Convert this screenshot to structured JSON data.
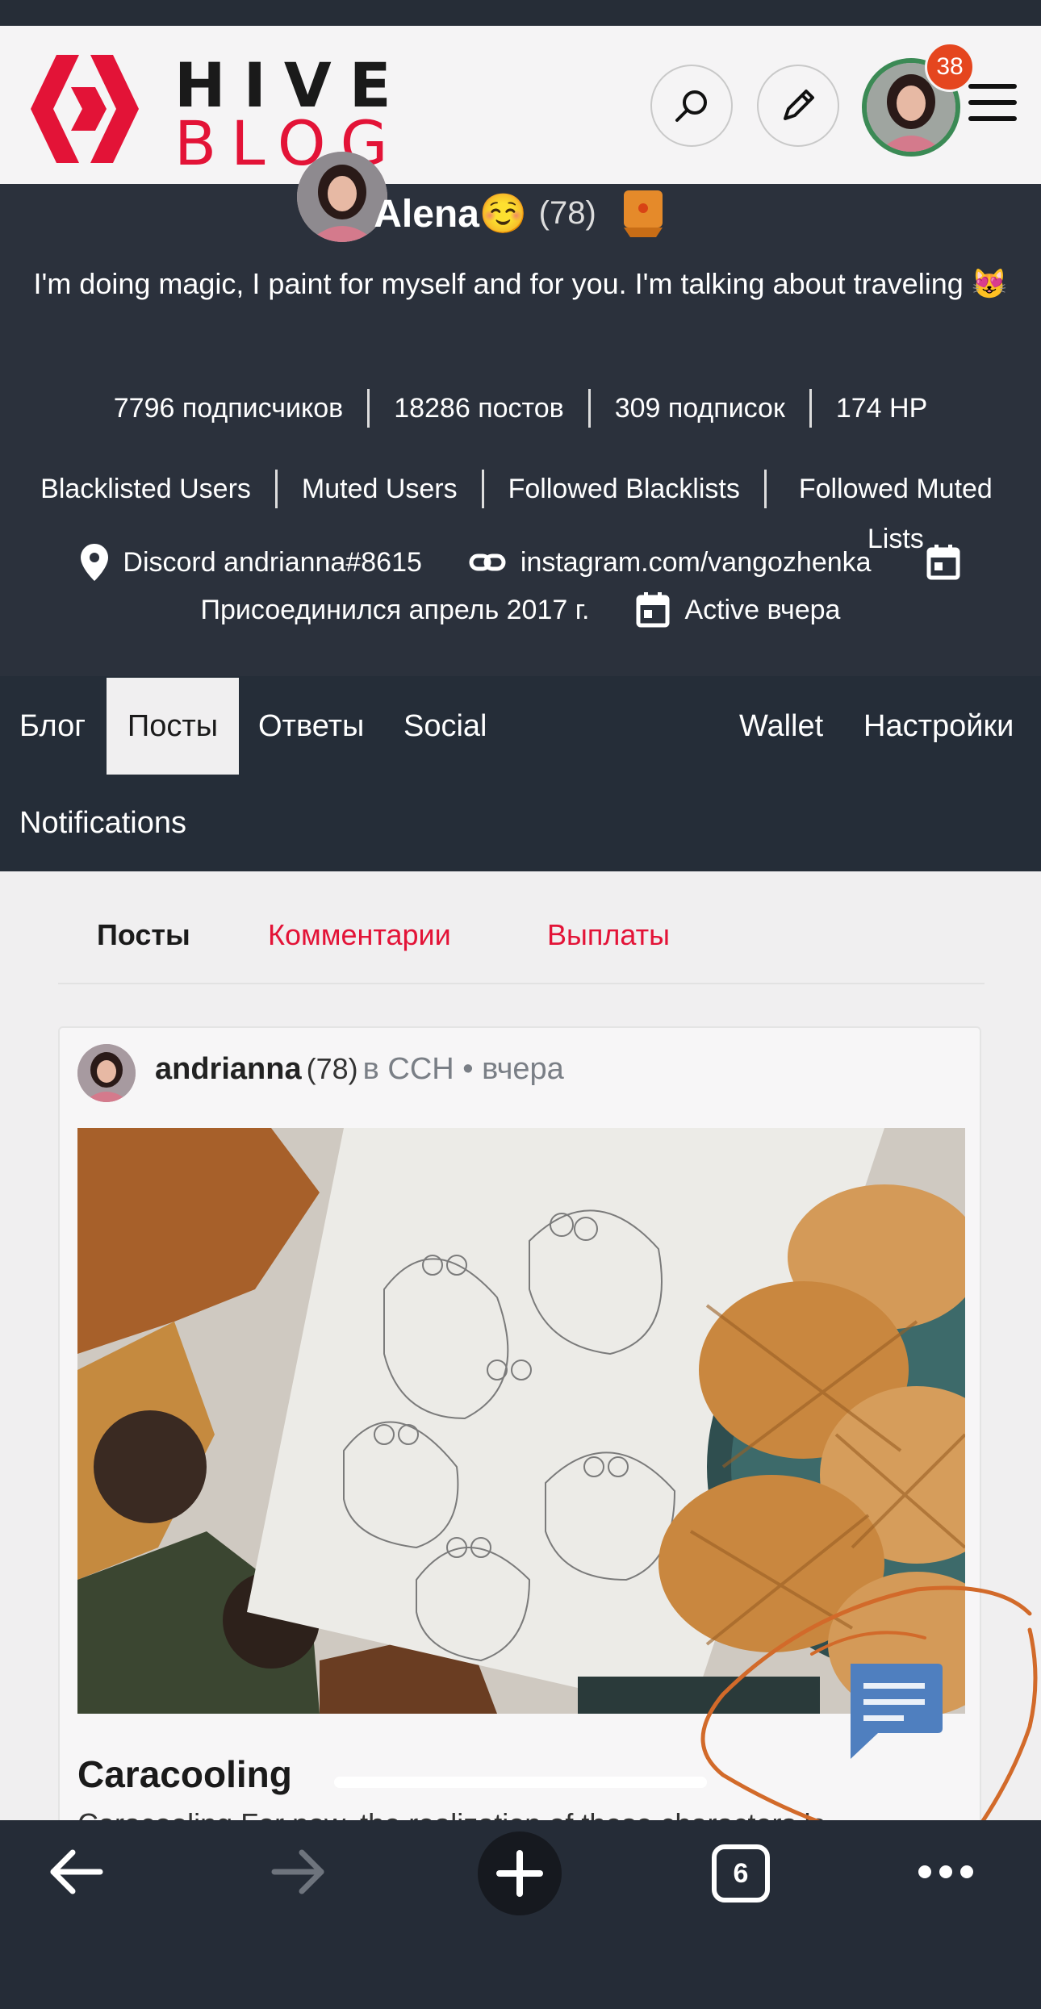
{
  "header": {
    "logo_top": "HIVE",
    "logo_bottom": "BLOG",
    "notification_count": "38",
    "brand_color": "#e31337"
  },
  "profile": {
    "name": "Alena☺️",
    "reputation": "(78)",
    "about": "I'm doing magic, I paint for myself and for you. I'm talking about traveling 😻",
    "followers": "7796 подписчиков",
    "posts": "18286 постов",
    "following": "309 подписок",
    "hp": "174 HP",
    "blacklisted_users": "Blacklisted Users",
    "muted_users": "Muted Users",
    "followed_blacklists": "Followed Blacklists",
    "followed_muted_lists": "Followed Muted Lists",
    "location": "Discord andrianna#8615",
    "website": "instagram.com/vangozhenka",
    "joined": "Присоединился апрель 2017 г.",
    "active": "Active вчера"
  },
  "tabs": {
    "blog": "Блог",
    "posts": "Посты",
    "replies": "Ответы",
    "social": "Social",
    "wallet": "Wallet",
    "settings": "Настройки",
    "notifications": "Notifications"
  },
  "subtabs": {
    "posts": "Посты",
    "comments": "Комментарии",
    "payouts": "Выплаты"
  },
  "post": {
    "author": "andrianna",
    "reputation": "(78)",
    "community_meta": "в ССН • вчера",
    "title": "Caracooling",
    "snippet": "Caracooling For now, the realization of these characters is"
  },
  "browser": {
    "tab_count": "6"
  }
}
